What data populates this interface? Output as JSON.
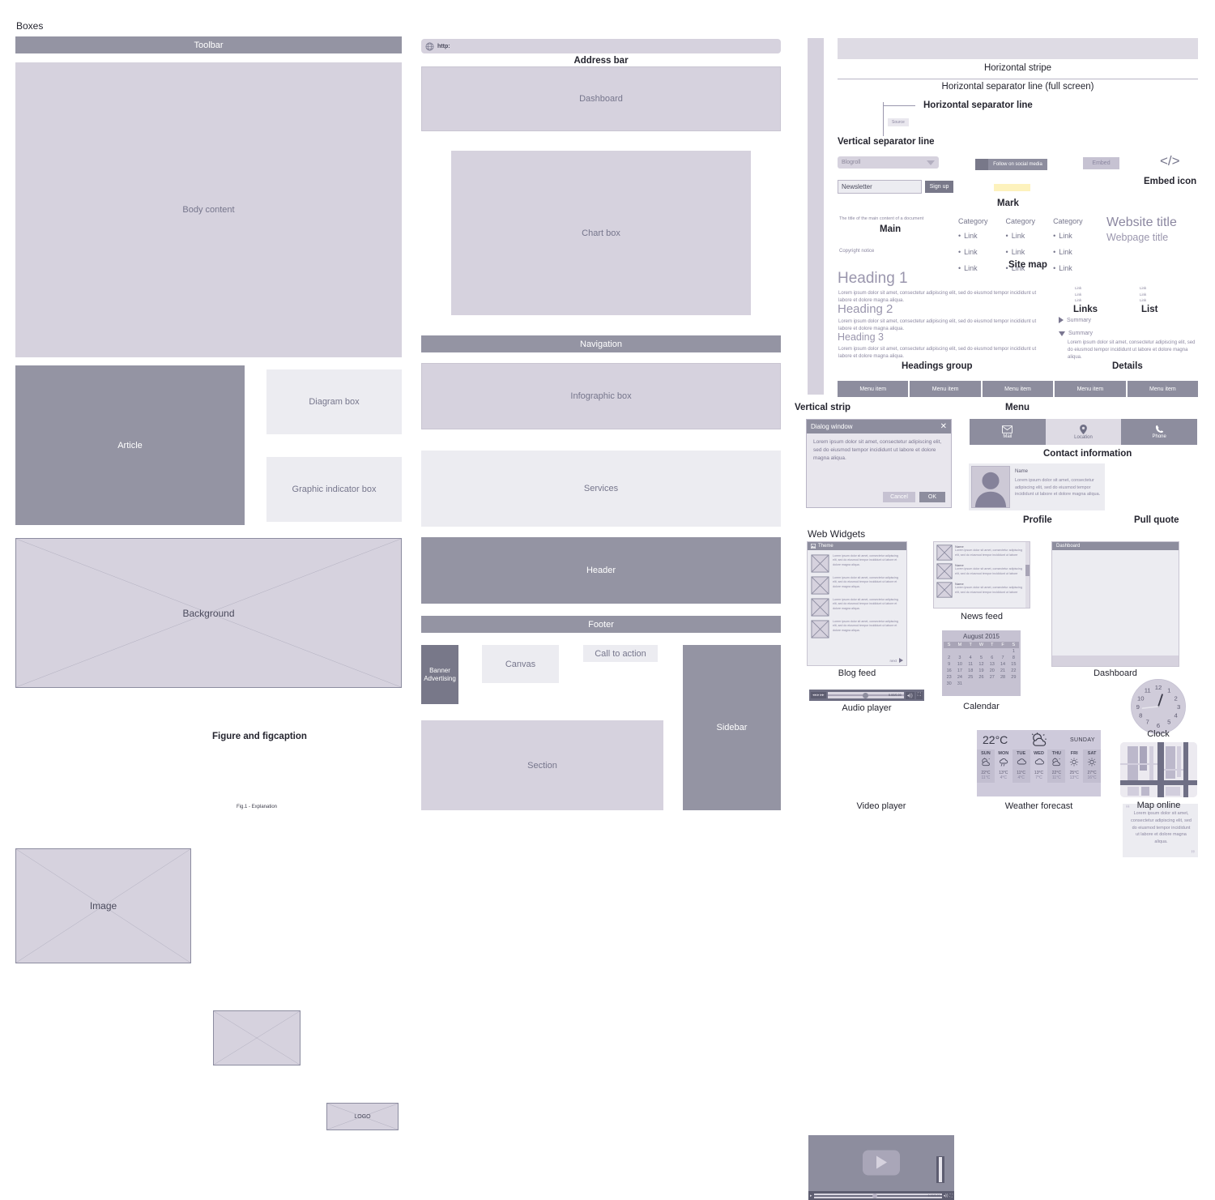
{
  "sections": {
    "boxes_title": "Boxes",
    "web_widgets_title": "Web Widgets"
  },
  "col_left": {
    "toolbar": "Toolbar",
    "body_content": "Body content",
    "article": "Article",
    "diagram_box": "Diagram box",
    "graphic_indicator_box": "Graphic indicator box",
    "background": "Background",
    "image": "Image",
    "figure_title": "Figure and figcaption",
    "figcaption": "Fig.1 - Explanation",
    "logo": "LOGO"
  },
  "col_mid": {
    "address_bar_value": "http:",
    "address_bar_label": "Address bar",
    "dashboard": "Dashboard",
    "chart_box": "Chart box",
    "navigation": "Navigation",
    "infographic_box": "Infographic box",
    "services": "Services",
    "header": "Header",
    "footer": "Footer",
    "banner_advertising": "Banner\nAdvertising",
    "canvas": "Canvas",
    "call_to_action": "Call to action",
    "section": "Section",
    "sidebar": "Sidebar"
  },
  "col_right": {
    "horizontal_stripe": "Horizontal stripe",
    "hr_full": "Horizontal separator line (full screen)",
    "hr_line": "Horizontal separator line",
    "source": "Source",
    "vertical_separator_line": "Vertical separator line",
    "blogroll": "Blogroll",
    "follow_social": "Follow on social media",
    "embed": "Embed",
    "embed_icon_glyph": "</>",
    "embed_icon_label": "Embed icon",
    "newsletter_placeholder": "Newsletter",
    "sign_up": "Sign up",
    "mark": "Mark",
    "main_desc": "The title of the main content of a document",
    "main": "Main",
    "copyright_notice": "Copyright notice",
    "site_map": "Site map",
    "categories": [
      {
        "title": "Category",
        "links": [
          "Link",
          "Link",
          "Link"
        ]
      },
      {
        "title": "Category",
        "links": [
          "Link",
          "Link",
          "Link"
        ]
      },
      {
        "title": "Category",
        "links": [
          "Link",
          "Link",
          "Link"
        ]
      }
    ],
    "website_title": "Website title",
    "webpage_title": "Webpage title",
    "heading1": "Heading 1",
    "heading2": "Heading 2",
    "heading3": "Heading 3",
    "lorem": "Lorem ipsum dolor sit amet, consectetur adipiscing elit, sed do eiusmod tempor incididunt ut labore et dolore magna aliqua.",
    "headings_group": "Headings group",
    "links_label": "Links",
    "list_label": "List",
    "links_items": [
      "Link",
      "Link",
      "Link"
    ],
    "list_items": [
      "Link",
      "Link",
      "Link"
    ],
    "summary_collapsed": "Summary",
    "summary_expanded": "Summary",
    "details_label": "Details",
    "menu_label": "Menu",
    "menu_items": [
      "Menu item",
      "Menu item",
      "Menu item",
      "Menu item",
      "Menu item"
    ],
    "vertical_strip": "Vertical strip",
    "dialog": {
      "title": "Dialog window",
      "body": "Lorem ipsum dolor sit amet, consectetur adipiscing elit, sed do eiusmod tempor incididunt ut labore et dolore magna aliqua.",
      "cancel": "Cancel",
      "ok": "OK",
      "close_glyph": "✕"
    },
    "contact": {
      "label": "Contact information",
      "items": [
        {
          "label": "Mail",
          "icon": "mail-icon"
        },
        {
          "label": "Location",
          "icon": "location-pin-icon"
        },
        {
          "label": "Phone",
          "icon": "phone-icon"
        }
      ]
    },
    "profile": {
      "label": "Profile",
      "name": "Name",
      "body": "Lorem ipsum dolor sit amet, consectetur adipiscing elit, sed do eiusmod tempor incididunt ut labore et dolore magna aliqua."
    },
    "pull_quote": {
      "label": "Pull quote",
      "body": "Lorem ipsum dolor sit amet, consectetur adipiscing elit, sed do eiusmod tempor incididunt ut labore et dolore magna aliqua.",
      "open_quote": "“",
      "close_quote": "”"
    }
  },
  "widgets": {
    "blog_feed": {
      "label": "Blog feed",
      "title": "Theme",
      "next": "next",
      "items": [
        "Lorem ipsum dolor sit amet, consectetur adipiscing elit, sed do eiusmod tempor incididunt ut labore et dolore magna aliqua.",
        "Lorem ipsum dolor sit amet, consectetur adipiscing elit, sed do eiusmod tempor incididunt ut labore et dolore magna aliqua.",
        "Lorem ipsum dolor sit amet, consectetur adipiscing elit, sed do eiusmod tempor incididunt ut labore et dolore magna aliqua.",
        "Lorem ipsum dolor sit amet, consectetur adipiscing elit, sed do eiusmod tempor incididunt ut labore et dolore magna aliqua."
      ]
    },
    "news_feed": {
      "label": "News feed",
      "items": [
        {
          "name": "Name",
          "body": "Lorem ipsum dolor sit amet, consectetur adipiscing elit, sed do eiusmod tempor incididunt ut labore"
        },
        {
          "name": "Name",
          "body": "Lorem ipsum dolor sit amet, consectetur adipiscing elit, sed do eiusmod tempor incididunt ut labore"
        },
        {
          "name": "Name",
          "body": "Lorem ipsum dolor sit amet, consectetur adipiscing elit, sed do eiusmod tempor incididunt ut labore"
        }
      ]
    },
    "dashboard": {
      "label": "Dashboard",
      "title": "Dashboard"
    },
    "audio_player": {
      "label": "Audio player",
      "time": "0.00/0.00"
    },
    "video_player": {
      "label": "Video player",
      "time": "0.00/0.00"
    },
    "calendar": {
      "label": "Calendar",
      "month": "August 2015",
      "weekdays": [
        "S",
        "M",
        "T",
        "W",
        "T",
        "F",
        "S"
      ],
      "weeks": [
        [
          "",
          "",
          "",
          "",
          "",
          "",
          "1"
        ],
        [
          "2",
          "3",
          "4",
          "5",
          "6",
          "7",
          "8"
        ],
        [
          "9",
          "10",
          "11",
          "12",
          "13",
          "14",
          "15"
        ],
        [
          "16",
          "17",
          "18",
          "19",
          "20",
          "21",
          "22"
        ],
        [
          "23",
          "24",
          "25",
          "26",
          "27",
          "28",
          "29"
        ],
        [
          "30",
          "31",
          "",
          "",
          "",
          "",
          ""
        ]
      ]
    },
    "clock": {
      "label": "Clock",
      "numbers": [
        "12",
        "1",
        "2",
        "3",
        "4",
        "5",
        "6",
        "7",
        "8",
        "9",
        "10",
        "11"
      ]
    },
    "map_online": {
      "label": "Map online"
    },
    "weather": {
      "label": "Weather forecast",
      "current_temp": "22°C",
      "current_day": "SUNDAY",
      "days": [
        {
          "day": "SUN",
          "icon": "sun-cloud-icon",
          "high": "22°C",
          "low": "11°C"
        },
        {
          "day": "MON",
          "icon": "rain-icon",
          "high": "13°C",
          "low": "4°C"
        },
        {
          "day": "TUE",
          "icon": "cloud-icon",
          "high": "11°C",
          "low": "4°C"
        },
        {
          "day": "WED",
          "icon": "cloud-icon",
          "high": "13°C",
          "low": "7°C"
        },
        {
          "day": "THU",
          "icon": "sun-cloud-icon",
          "high": "22°C",
          "low": "11°C"
        },
        {
          "day": "FRI",
          "icon": "sun-icon",
          "high": "25°C",
          "low": "13°C"
        },
        {
          "day": "SAT",
          "icon": "sun-icon",
          "high": "27°C",
          "low": "16°C"
        }
      ]
    }
  },
  "colors": {
    "dark": "#9494a3",
    "darker": "#787889",
    "mid": "#d6d2de",
    "light": "#ececf1",
    "mark": "#fdf2bd"
  }
}
